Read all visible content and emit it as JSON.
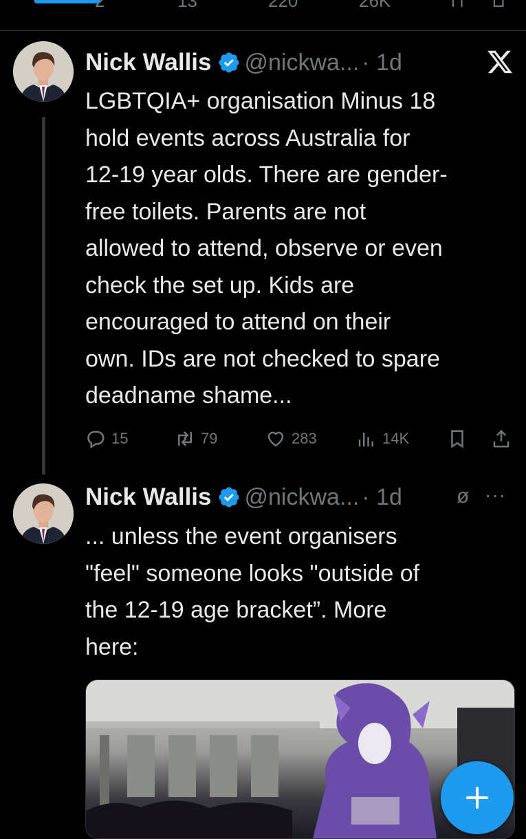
{
  "top_actions": {
    "replies": "2",
    "reposts": "13",
    "likes": "220",
    "views": "26K"
  },
  "tweets": [
    {
      "author_name": "Nick Wallis",
      "handle": "@nickwa...",
      "time": "· 1d",
      "text_lines": [
        "LGBTQIA+ organisation Minus 18",
        "hold events across Australia for",
        "12-19 year olds. There are gender-",
        "free toilets. Parents are not",
        "allowed to attend, observe or even",
        "check the set up. Kids are",
        "encouraged to attend on their",
        "own. IDs are not checked to spare",
        "deadname shame..."
      ],
      "replies": "15",
      "reposts": "79",
      "likes": "283",
      "views": "14K"
    },
    {
      "author_name": "Nick Wallis",
      "handle": "@nickwa...",
      "time": "· 1d",
      "text_lines": [
        "... unless the event organisers",
        "\"feel\" someone looks \"outside of",
        "the 12-19 age bracket”. More",
        "here:"
      ]
    }
  ],
  "icons": {
    "verified": "verified-badge-icon",
    "platform": "x-logo-icon",
    "muted": "muted-icon",
    "more": "more-icon",
    "compose": "plus-icon"
  },
  "colors": {
    "background": "#000000",
    "text": "#e7e9ea",
    "secondary": "#71767b",
    "accent": "#1d9bf0"
  },
  "fab": {
    "label": "+"
  }
}
